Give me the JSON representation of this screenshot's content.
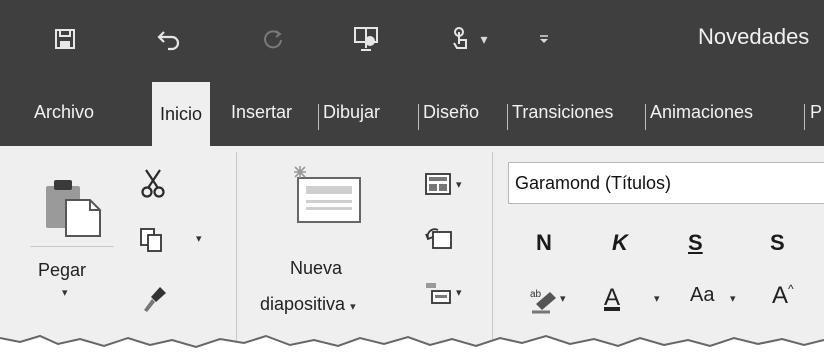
{
  "title": "Novedades",
  "tabs": [
    "Archivo",
    "Inicio",
    "Insertar",
    "Dibujar",
    "Diseño",
    "Transiciones",
    "Animaciones",
    "P"
  ],
  "active_tab": "Inicio",
  "clipboard": {
    "paste_label": "Pegar",
    "caret": "▾"
  },
  "slides": {
    "new_slide_line1": "Nueva",
    "new_slide_line2": "diapositiva",
    "caret": "▾"
  },
  "font": {
    "family": "Garamond (Títulos)",
    "bold": "N",
    "italic": "K",
    "underline": "S",
    "strikethrough": "S",
    "case_label": "Aa",
    "grow_label": "A",
    "color_label": "A"
  },
  "icons": {
    "save": "save-icon",
    "undo": "undo-icon",
    "redo": "redo-icon",
    "presenter": "presenter-icon",
    "touch": "touch-mode-icon",
    "customize": "customize-qat-icon",
    "paste": "paste-icon",
    "cut": "scissors-icon",
    "copy": "copy-icon",
    "format_painter": "format-painter-icon",
    "new_slide": "new-slide-icon",
    "layout": "layout-icon",
    "reset": "reset-icon",
    "section": "section-icon",
    "highlight": "highlighter-icon"
  },
  "colors": {
    "titlebar": "#3f3f3f",
    "ribbon": "#efefef"
  }
}
